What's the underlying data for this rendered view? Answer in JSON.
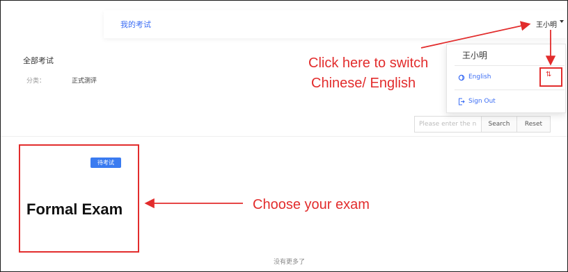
{
  "header": {
    "nav_link": "我的考试",
    "user_name": "王小明"
  },
  "filters": {
    "title": "全部考试",
    "category_label": "分类：",
    "category_value": "正式测评"
  },
  "search": {
    "placeholder": "Please enter the n",
    "search_label": "Search",
    "reset_label": "Reset"
  },
  "user_menu": {
    "name": "王小明",
    "language_label": "English",
    "switch_icon": "switch-icon",
    "sign_out_label": "Sign Out"
  },
  "exam_card": {
    "status_badge": "待考试",
    "title": "Formal Exam"
  },
  "list_footer": "没有更多了",
  "annotations": {
    "switch_line1": "Click here to switch",
    "switch_line2": "Chinese/ English",
    "choose": "Choose your exam"
  },
  "colors": {
    "accent": "#3a7bf0",
    "link": "#3a6cf4",
    "annotation": "#e22c2c"
  }
}
